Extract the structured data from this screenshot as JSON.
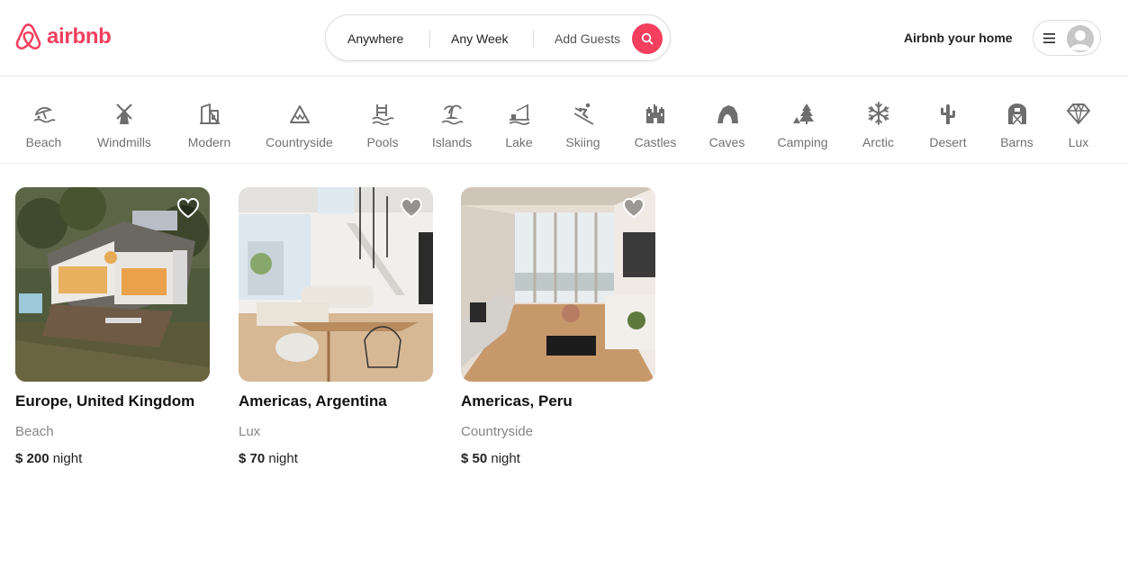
{
  "brand": {
    "name": "airbnb",
    "color": "#f43f5e"
  },
  "search": {
    "anywhere": "Anywhere",
    "week": "Any Week",
    "guests": "Add Guests",
    "button_icon": "search-icon"
  },
  "header_right": {
    "host_link": "Airbnb your home",
    "menu_icon": "hamburger-icon",
    "avatar_icon": "user-avatar"
  },
  "categories": [
    {
      "label": "Beach",
      "icon": "beach-icon"
    },
    {
      "label": "Windmills",
      "icon": "windmill-icon"
    },
    {
      "label": "Modern",
      "icon": "modern-building-icon"
    },
    {
      "label": "Countryside",
      "icon": "mountain-icon"
    },
    {
      "label": "Pools",
      "icon": "pool-icon"
    },
    {
      "label": "Islands",
      "icon": "island-icon"
    },
    {
      "label": "Lake",
      "icon": "lake-icon"
    },
    {
      "label": "Skiing",
      "icon": "skiing-icon"
    },
    {
      "label": "Castles",
      "icon": "castle-icon"
    },
    {
      "label": "Caves",
      "icon": "cave-icon"
    },
    {
      "label": "Camping",
      "icon": "camping-icon"
    },
    {
      "label": "Arctic",
      "icon": "snowflake-icon"
    },
    {
      "label": "Desert",
      "icon": "cactus-icon"
    },
    {
      "label": "Barns",
      "icon": "barn-icon"
    },
    {
      "label": "Lux",
      "icon": "diamond-icon"
    }
  ],
  "listings": [
    {
      "title": "Europe, United Kingdom",
      "category": "Beach",
      "price": "$ 200",
      "unit": "night"
    },
    {
      "title": "Americas, Argentina",
      "category": "Lux",
      "price": "$ 70",
      "unit": "night"
    },
    {
      "title": "Americas, Peru",
      "category": "Countryside",
      "price": "$ 50",
      "unit": "night"
    }
  ]
}
